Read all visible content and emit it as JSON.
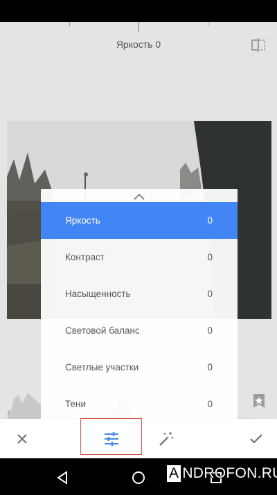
{
  "header": {
    "title": "Яркость 0",
    "compare_icon": "split-compare-icon"
  },
  "menu": {
    "items": [
      {
        "label": "Яркость",
        "value": "0",
        "selected": true
      },
      {
        "label": "Контраст",
        "value": "0",
        "selected": false
      },
      {
        "label": "Насыщенность",
        "value": "0",
        "selected": false
      },
      {
        "label": "Световой баланс",
        "value": "0",
        "selected": false
      },
      {
        "label": "Светлые участки",
        "value": "0",
        "selected": false
      },
      {
        "label": "Тени",
        "value": "0",
        "selected": false
      }
    ]
  },
  "toolbar": {
    "cancel_icon": "close-icon",
    "adjust_icon": "sliders-icon",
    "auto_icon": "magic-wand-icon",
    "apply_icon": "checkmark-icon"
  },
  "watermark": {
    "prefix": "A",
    "rest": "NDROFON.RU"
  },
  "colors": {
    "accent": "#4285f4",
    "highlight_box": "#d9534f",
    "icon_blue": "#4285f4"
  }
}
